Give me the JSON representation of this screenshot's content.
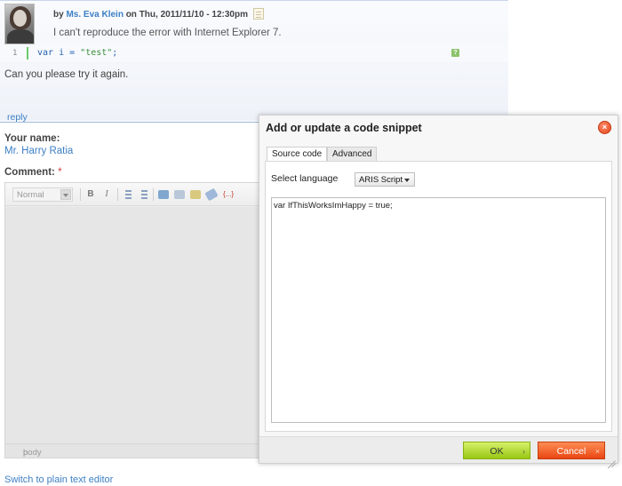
{
  "comment": {
    "by_prefix": "by",
    "author": "Ms. Eva Klein",
    "on_text": "on Thu, 2011/11/10 - 12:30pm",
    "text": "I can't reproduce the error with Internet Explorer 7.",
    "code_line_number": "1",
    "code_keyword": "var i = ",
    "code_string": "\"test\"",
    "code_end": ";",
    "help_icon_text": "?",
    "text2": "Can you please try it again.",
    "reply_label": "reply"
  },
  "form": {
    "name_label": "Your name:",
    "name_value": "Mr. Harry Ratia",
    "comment_label": "Comment:",
    "required_mark": "*",
    "format_select": "Normal",
    "bold": "B",
    "italic": "I",
    "status_body": "body",
    "status_p": "p",
    "code_icon": "{...}",
    "switch_link": "Switch to plain text editor"
  },
  "dialog": {
    "title": "Add or update a code snippet",
    "close_icon": "×",
    "tabs": [
      {
        "label": "Source code",
        "active": true
      },
      {
        "label": "Advanced",
        "active": false
      }
    ],
    "language_label": "Select language",
    "language_value": "ARIS Script",
    "code_text": "var IfThisWorksImHappy = true;",
    "ok_label": "OK",
    "cancel_label": "Cancel"
  },
  "colors": {
    "link": "#3d7fc5",
    "ok_button": "#97c714",
    "cancel_button": "#e84613"
  }
}
